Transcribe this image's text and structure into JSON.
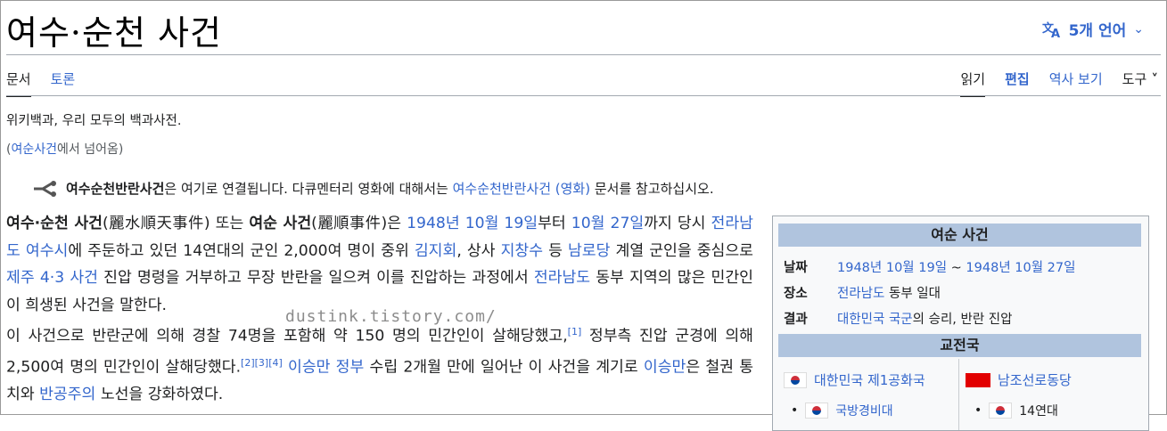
{
  "page": {
    "title": "여수·순천 사건",
    "language_button": "5개 언어"
  },
  "tabs_left": [
    "문서",
    "토론"
  ],
  "tabs_right": [
    "읽기",
    "편집",
    "역사 보기",
    "도구"
  ],
  "tagline": "위키백과, 우리 모두의 백과사전.",
  "redirect": {
    "open": "(",
    "link": "여순사건",
    "rest": "에서 넘어옴)"
  },
  "hatnote": {
    "bold": "여수순천반란사건",
    "text1": "은 여기로 연결됩니다. 다큐멘터리 영화에 대해서는 ",
    "link": "여수순천반란사건 (영화)",
    "text2": " 문서를 참고하십시오."
  },
  "paragraph1": {
    "b1": "여수·순천 사건",
    "t1": "(麗水順天事件) 또는 ",
    "b2": "여순 사건",
    "t2": "(麗順事件)은 ",
    "l1": "1948년 10월 19일",
    "t3": "부터 ",
    "l2": "10월 27일",
    "t4": "까지 당시 ",
    "l3": "전라남도",
    "t5": " ",
    "l4": "여수시",
    "t6": "에 주둔하고 있던 14연대의 군인 2,000여 명이 중위 ",
    "l5": "김지회",
    "t7": ", 상사 ",
    "l6": "지창수",
    "t8": " 등 ",
    "l7": "남로당",
    "t9": " 계열 군인을 중심으로 ",
    "l8": "제주 4·3 사건",
    "t10": " 진압 명령을 거부하고 무장 반란을 일으켜 이를 진압하는 과정에서 ",
    "l9": "전라남도",
    "t11": " 동부 지역의 많은 민간인이 희생된 사건을 말한다."
  },
  "paragraph2": {
    "t1": "이 사건으로 반란군에 의해 경찰 74명을 포함해 약 150 명의 민간인이 살해당했고,",
    "s1": "[1]",
    "t2": " 정부측 진압 군경에 의해 2,500여 명의 민간인이 살해당했다.",
    "s2": "[2]",
    "s3": "[3]",
    "s4": "[4]",
    "t3": " ",
    "l1": "이승만 정부",
    "t4": " 수립 2개월 만에 일어난 이 사건을 계기로 ",
    "l2": "이승만",
    "t5": "은 철권 통치와 ",
    "l3": "반공주의",
    "t6": " 노선을 강화하였다."
  },
  "watermark": "dustink.tistory.com/",
  "infobox": {
    "title": "여순 사건",
    "rows": [
      {
        "label": "날짜",
        "link1": "1948년 10월 19일",
        "sep": " ~ ",
        "link2": "1948년 10월 27일"
      },
      {
        "label": "장소",
        "link1": "전라남도",
        "text": " 동부 일대"
      },
      {
        "label": "결과",
        "link1": "대한민국 국군",
        "text": "의 승리, 반란 진압"
      }
    ],
    "belligerents_title": "교전국",
    "side_a": "대한민국 제1공화국",
    "side_b": "남조선로동당",
    "side_a_sub": "국방경비대",
    "side_b_sub": "14연대"
  },
  "colors": {
    "link": "#3366cc",
    "infobox_header": "#b0c4de",
    "text": "#202122"
  }
}
